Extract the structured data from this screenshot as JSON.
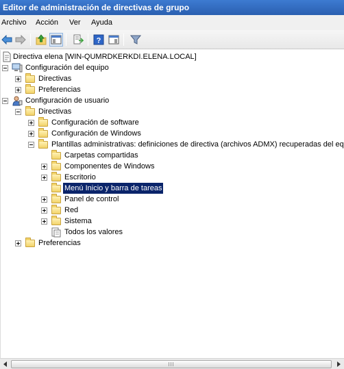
{
  "window": {
    "title": "Editor de administración de directivas de grupo"
  },
  "menu": {
    "archivo": "Archivo",
    "accion": "Acción",
    "ver": "Ver",
    "ayuda": "Ayuda"
  },
  "toolbar": {
    "icons": [
      "back-arrow-icon",
      "forward-arrow-icon",
      "up-folder-icon",
      "show-hide-tree-icon",
      "export-list-icon",
      "help-icon",
      "show-hide-action-pane-icon",
      "filter-icon"
    ]
  },
  "tree": {
    "root": "Directiva elena [WIN-QUMRDKERKDI.ELENA.LOCAL]",
    "equipo": "Configuración del equipo",
    "equipo_directivas": "Directivas",
    "equipo_preferencias": "Preferencias",
    "usuario": "Configuración de usuario",
    "usuario_directivas": "Directivas",
    "software": "Configuración de software",
    "windows": "Configuración de Windows",
    "plantillas": "Plantillas administrativas: definiciones de directiva (archivos ADMX) recuperadas del equi",
    "carpetas": "Carpetas compartidas",
    "componentes": "Componentes de Windows",
    "escritorio": "Escritorio",
    "menu_inicio": "Menú Inicio y barra de tareas",
    "panel": "Panel de control",
    "red": "Red",
    "sistema": "Sistema",
    "todos": "Todos los valores",
    "usuario_preferencias": "Preferencias"
  },
  "selection": "Menú Inicio y barra de tareas",
  "colors": {
    "title_bar": "#2f67bd",
    "selection": "#0a246a",
    "folder": "#f2d36a"
  }
}
